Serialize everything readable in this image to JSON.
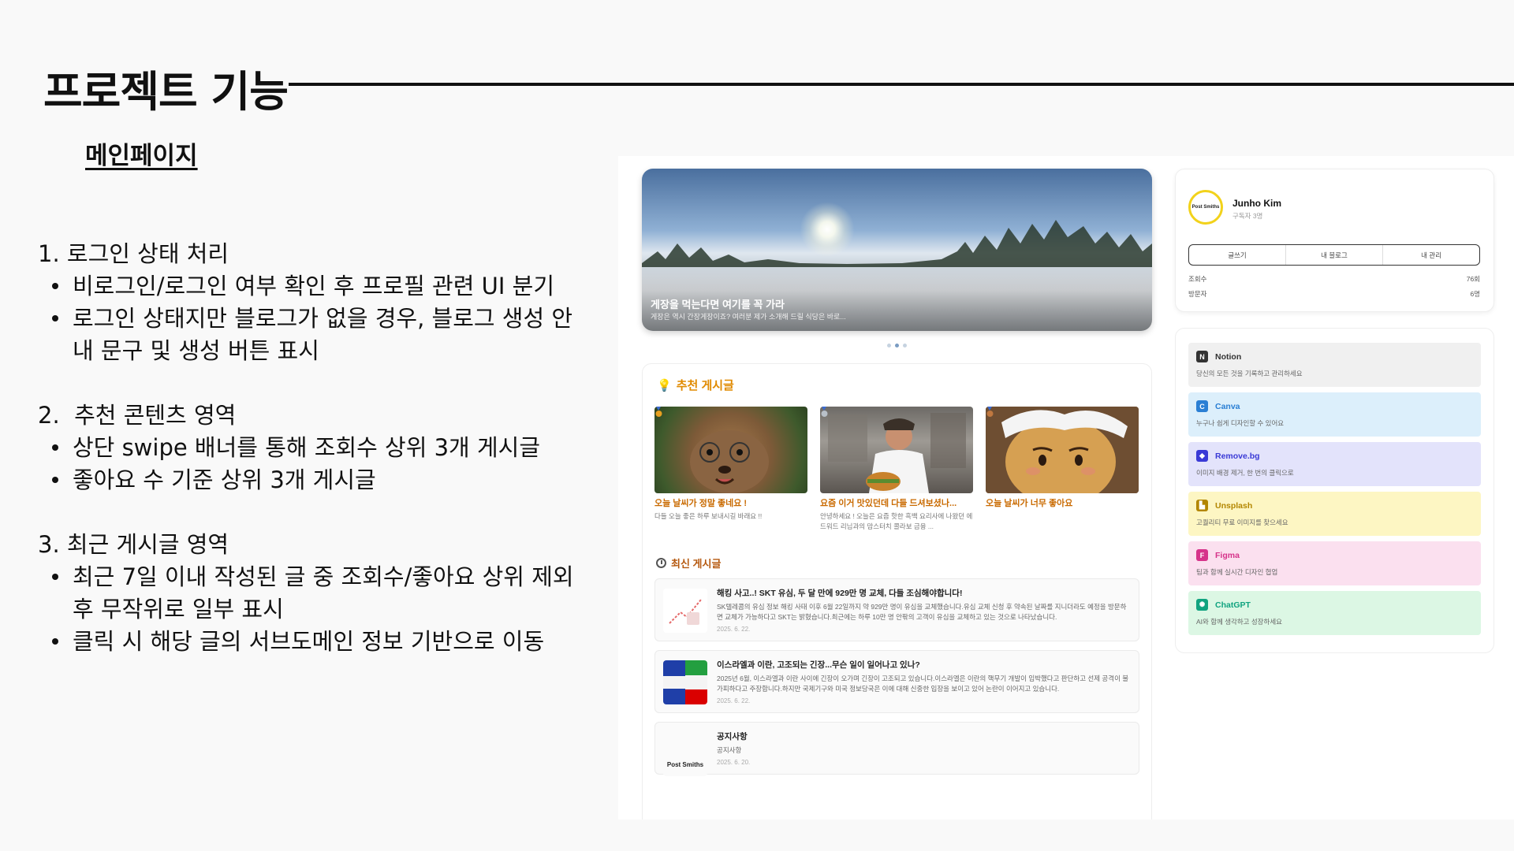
{
  "slide": {
    "title": "프로젝트 기능",
    "subtitle": "메인페이지",
    "sections": [
      {
        "number": "1.",
        "heading": "로그인 상태 처리",
        "bullets": [
          "비로그인/로그인 여부 확인 후 프로필 관련 UI 분기",
          "로그인 상태지만 블로그가 없을 경우, 블로그 생성 안내 문구 및 생성 버튼 표시"
        ]
      },
      {
        "number": "2.",
        "heading": "추천 콘텐츠 영역",
        "bullets": [
          "상단 swipe 배너를 통해 조회수 상위 3개 게시글",
          "좋아요 수 기준 상위 3개 게시글"
        ]
      },
      {
        "number": "3.",
        "heading": "최근 게시글 영역",
        "bullets": [
          "최근 7일 이내 작성된 글 중 조회수/좋아요 상위 제외 후 무작위로 일부 표시",
          "클릭 시 해당 글의 서브도메인 정보 기반으로 이동"
        ]
      }
    ]
  },
  "screenshot": {
    "banner": {
      "title": "게장을 먹는다면 여기를 꼭 가라",
      "desc": "게장은 역시 간장게장이죠? 여러분 제가 소개해 드릴 식당은 바로..."
    },
    "recommended": {
      "label": "추천 게시글",
      "cards": [
        {
          "title": "오늘 날씨가 정말 좋네요 !",
          "desc": "다들 오늘 좋은 하루 보내시길 바래요 !!"
        },
        {
          "title": "요즘 이거 맛있던데 다들 드셔보셨나...",
          "desc": "안녕하세요 ! 오늘은 요즘 핫한 흑백 요리사에 나왔던 에드워드 리님과의 맘스터치 콜라보 금융 ..."
        },
        {
          "title": "오늘 날씨가 너무 좋아요",
          "desc": ""
        }
      ]
    },
    "recent": {
      "label": "최신 게시글",
      "posts": [
        {
          "title": "해킹 사고..! SKT 유심, 두 달 만에 929만 명 교체, 다들 조심해야합니다!",
          "body": "SK텔레콤의 유심 정보 해킹 사태 이후 6월 22일까지 약 929만 명이 유심을 교체했습니다.유심 교체 신청 후 약속된 날짜를 지니더라도 예정을 방문하면 교체가 가능하다고 SKT는 밝혔습니다.최근에는 하루 10만 명 안팎의 고객이 유심을 교체하고 있는 것으로 나타났습니다.",
          "date": "2025. 6. 22."
        },
        {
          "title": "이스라엘과 이란, 고조되는 긴장...무슨 일이 일어나고 있나?",
          "body": "2025년 6월, 이스라엘과 이란 사이에 긴장이 오가며 긴장이 고조되고 있습니다.이스라엘은 이란의 핵무기 개발이 임박했다고 판단하고 선제 공격이 불가피하다고 주장합니다.하지만 국제기구와 미국 정보당국은 이에 대해 신중한 입장을 보이고 있어 논란이 이어지고 있습니다.",
          "date": "2025. 6. 22."
        },
        {
          "title": "공지사항",
          "body": "공지사항",
          "date": "2025. 6. 20.",
          "thumb_text": "Post Smiths"
        }
      ]
    },
    "profile": {
      "avatar_text": "Post Smiths",
      "name": "Junho Kim",
      "subs": "구독자 3명",
      "tabs": [
        "글쓰기",
        "내 블로그",
        "내 관리"
      ],
      "views_label": "조회수",
      "views_value": "76회",
      "visitors_label": "방문자",
      "visitors_value": "6명"
    },
    "tools": [
      {
        "name": "Notion",
        "desc": "당신의 모든 것을 기록하고 관리하세요",
        "bg": "#f0f0f0",
        "icon_bg": "#333333",
        "icon": "notion-icon",
        "glyph": "N"
      },
      {
        "name": "Canva",
        "desc": "누구나 쉽게 디자인할 수 있어요",
        "bg": "#dceffb",
        "icon_bg": "#2a7fd4",
        "icon": "canva-icon",
        "glyph": "C"
      },
      {
        "name": "Remove.bg",
        "desc": "이미지 배경 제거, 한 번의 클릭으로",
        "bg": "#e3e3fb",
        "icon_bg": "#3a3ad6",
        "icon": "removebg-icon",
        "glyph": "◆"
      },
      {
        "name": "Unsplash",
        "desc": "고퀄리티 무료 이미지를 찾으세요",
        "bg": "#fdf6c3",
        "icon_bg": "#b38600",
        "icon": "unsplash-icon",
        "glyph": "▙"
      },
      {
        "name": "Figma",
        "desc": "팀과 함께 실시간 디자인 협업",
        "bg": "#fbe0ef",
        "icon_bg": "#d6338a",
        "icon": "figma-icon",
        "glyph": "F"
      },
      {
        "name": "ChatGPT",
        "desc": "AI와 함께 생각하고 성장하세요",
        "bg": "#dcf7e4",
        "icon_bg": "#10a37f",
        "icon": "chatgpt-icon",
        "glyph": "✺"
      }
    ]
  }
}
